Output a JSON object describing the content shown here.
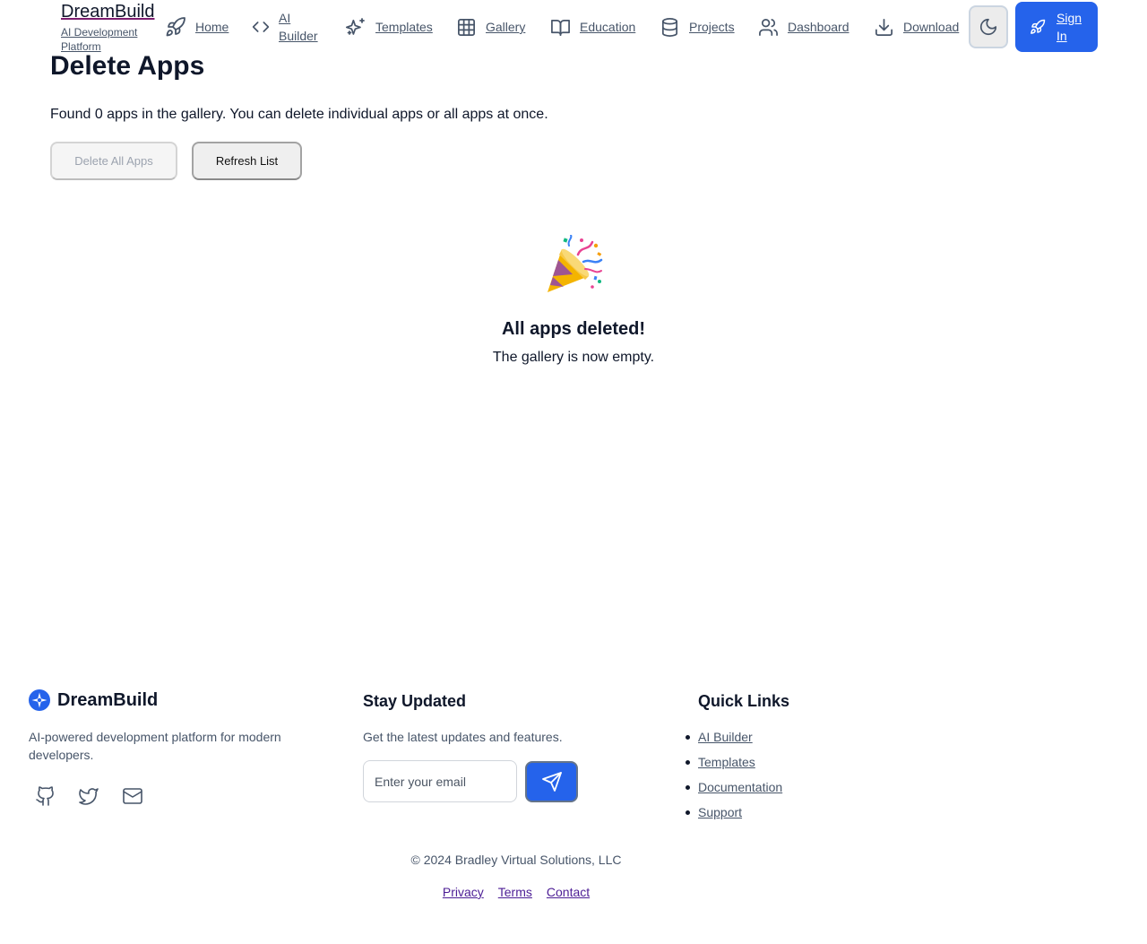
{
  "nav": {
    "brand_name": "DreamBuild",
    "brand_sub": "AI Development Platform",
    "links": [
      {
        "label": "Home",
        "icon": "rocket-icon"
      },
      {
        "label": "AI Builder",
        "icon": "code-icon"
      },
      {
        "label": "Templates",
        "icon": "sparkles-icon"
      },
      {
        "label": "Gallery",
        "icon": "grid-icon"
      },
      {
        "label": "Education",
        "icon": "book-icon"
      },
      {
        "label": "Projects",
        "icon": "database-icon"
      },
      {
        "label": "Dashboard",
        "icon": "users-icon"
      },
      {
        "label": "Download",
        "icon": "download-icon"
      }
    ],
    "theme_icon": "moon-icon",
    "signin_label": "Sign In"
  },
  "main": {
    "title": "Delete Apps",
    "found_text": "Found 0 apps in the gallery. You can delete individual apps or all apps at once.",
    "delete_all_label": "Delete All Apps",
    "refresh_label": "Refresh List",
    "empty_icon": "party-popper-icon",
    "empty_title": "All apps deleted!",
    "empty_sub": "The gallery is now empty."
  },
  "footer": {
    "brand_name": "DreamBuild",
    "brand_desc": "AI-powered development platform for modern developers.",
    "social": [
      "github-icon",
      "twitter-icon",
      "mail-icon"
    ],
    "stay_title": "Stay Updated",
    "stay_desc": "Get the latest updates and features.",
    "email_placeholder": "Enter your email",
    "quick_title": "Quick Links",
    "quick_links": [
      "AI Builder",
      "Templates",
      "Documentation",
      "Support"
    ],
    "copyright": "© 2024 Bradley Virtual Solutions, LLC",
    "legal": [
      "Privacy",
      "Terms",
      "Contact"
    ]
  },
  "colors": {
    "accent": "#2563eb",
    "text": "#0f172a",
    "muted": "#475569"
  }
}
